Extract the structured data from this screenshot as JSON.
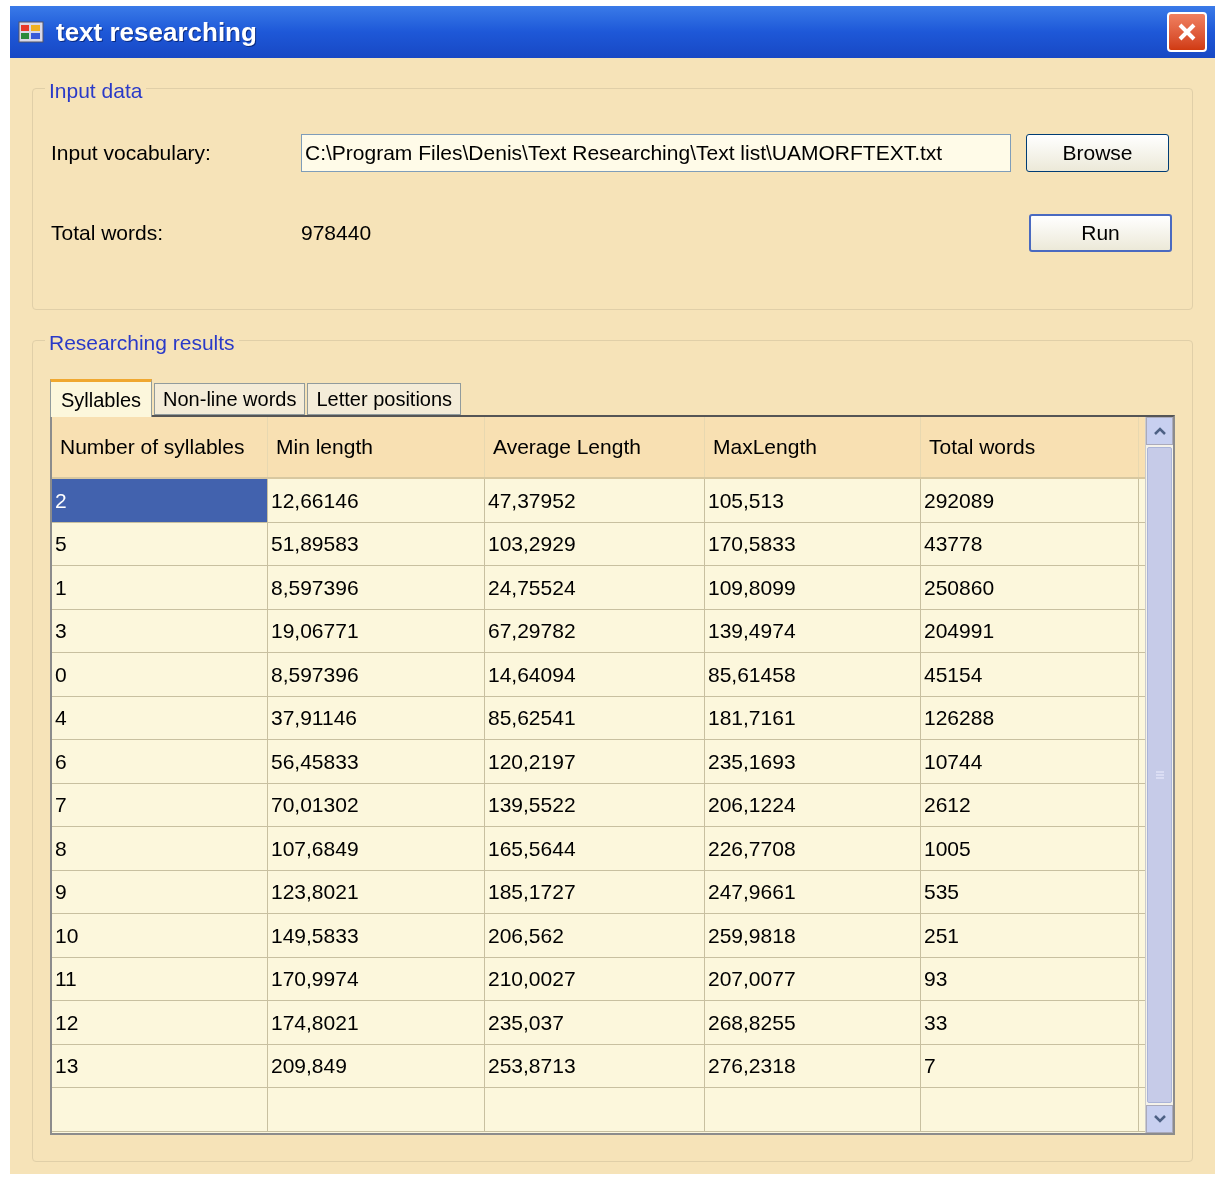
{
  "window": {
    "title": "text researching"
  },
  "input_data": {
    "title": "Input data",
    "vocabulary_label": "Input vocabulary:",
    "vocabulary_value": "C:\\Program Files\\Denis\\Text Researching\\Text list\\UAMORFTEXT.txt",
    "browse_button": "Browse",
    "total_label": "Total words:",
    "total_value": "978440",
    "run_button": "Run"
  },
  "results": {
    "title": "Researching results",
    "tabs": [
      {
        "label": "Syllables",
        "selected": true
      },
      {
        "label": "Non-line words",
        "selected": false
      },
      {
        "label": "Letter positions",
        "selected": false
      }
    ],
    "table": {
      "columns": [
        "Number of syllables",
        "Min length",
        "Average Length",
        "MaxLength",
        "Total words"
      ],
      "rows": [
        {
          "cells": [
            "2",
            "12,66146",
            "47,37952",
            "105,513",
            "292089"
          ],
          "selected": true
        },
        {
          "cells": [
            "5",
            "51,89583",
            "103,2929",
            "170,5833",
            "43778"
          ],
          "selected": false
        },
        {
          "cells": [
            "1",
            "8,597396",
            "24,75524",
            "109,8099",
            "250860"
          ],
          "selected": false
        },
        {
          "cells": [
            "3",
            "19,06771",
            "67,29782",
            "139,4974",
            "204991"
          ],
          "selected": false
        },
        {
          "cells": [
            "0",
            "8,597396",
            "14,64094",
            "85,61458",
            "45154"
          ],
          "selected": false
        },
        {
          "cells": [
            "4",
            "37,91146",
            "85,62541",
            "181,7161",
            "126288"
          ],
          "selected": false
        },
        {
          "cells": [
            "6",
            "56,45833",
            "120,2197",
            "235,1693",
            "10744"
          ],
          "selected": false
        },
        {
          "cells": [
            "7",
            "70,01302",
            "139,5522",
            "206,1224",
            "2612"
          ],
          "selected": false
        },
        {
          "cells": [
            "8",
            "107,6849",
            "165,5644",
            "226,7708",
            "1005"
          ],
          "selected": false
        },
        {
          "cells": [
            "9",
            "123,8021",
            "185,1727",
            "247,9661",
            "535"
          ],
          "selected": false
        },
        {
          "cells": [
            "10",
            "149,5833",
            "206,562",
            "259,9818",
            "251"
          ],
          "selected": false
        },
        {
          "cells": [
            "11",
            "170,9974",
            "210,0027",
            "207,0077",
            "93"
          ],
          "selected": false
        },
        {
          "cells": [
            "12",
            "174,8021",
            "235,037",
            "268,8255",
            "33"
          ],
          "selected": false
        },
        {
          "cells": [
            "13",
            "209,849",
            "253,8713",
            "276,2318",
            "7"
          ],
          "selected": false
        }
      ]
    }
  }
}
